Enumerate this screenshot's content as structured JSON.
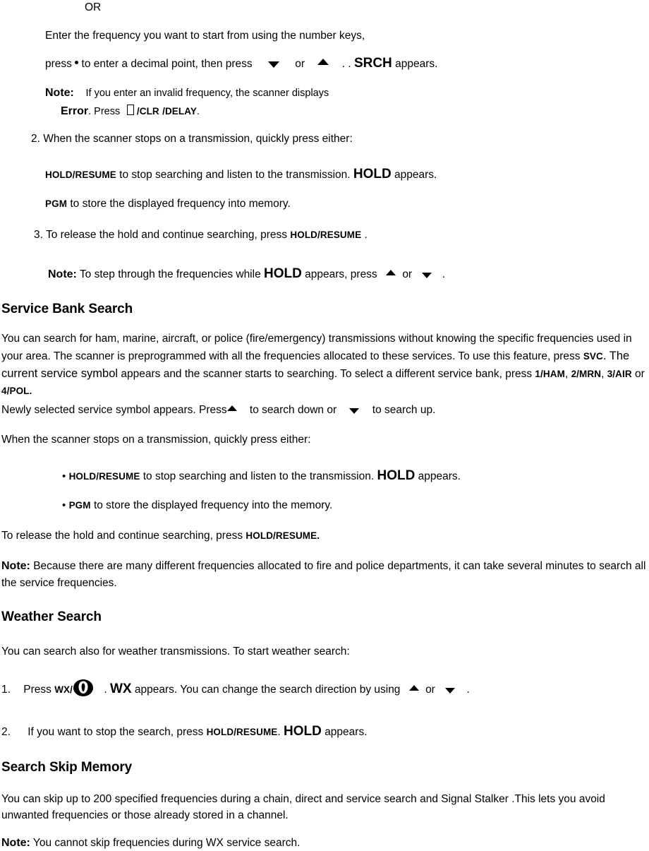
{
  "document": {
    "type": "scanner-manual-page",
    "background_color": "#ffffff",
    "text_color": "#000000"
  },
  "direct_search_continued": {
    "or_label": "OR",
    "enter_freq_line1": "Enter the frequency you want to start from using the number keys,",
    "enter_freq_line2_a": "press",
    "enter_freq_line2_b": "to enter a decimal point, then press",
    "enter_freq_line2_c": "or",
    "enter_freq_line2_d": ". .",
    "enter_freq_line2_srch": "SRCH",
    "enter_freq_line2_e": "appears.",
    "note_label": "Note:",
    "note_text_line1": "If you enter an invalid frequency, the scanner displays",
    "note_error_word": "Error",
    "note_press": ". Press",
    "note_clr": "/CLR",
    "note_delay": "/DELAY",
    "note_period": ".",
    "step2_number": "2.",
    "step2_text": "When the scanner stops on a transmission, quickly press either:",
    "step2_hold_key": "HOLD/RESUME",
    "step2_hold_text": "to stop searching and listen to the transmission.",
    "step2_hold_display": "HOLD",
    "step2_hold_appears": "appears.",
    "step2_pgm_key": "PGM",
    "step2_pgm_text": "to store the displayed frequency into memory.",
    "step3_number": "3.",
    "step3_text_a": "To release the hold and continue searching, press",
    "step3_key": "HOLD/RESUME",
    "step3_text_b": ".",
    "step3_note_label": "Note:",
    "step3_note_a": "To step through the frequencies while",
    "step3_note_hold": "HOLD",
    "step3_note_b": "appears, press",
    "step3_note_or": "or",
    "step3_note_c": "."
  },
  "service_bank_search": {
    "heading": "Service Bank Search",
    "para1_a": "You can search for ham, marine, aircraft, or police (fire/emergency) transmissions without knowing the specific frequencies used in your area. The scanner is preprogrammed with all the frequencies allocated to these services. To use this feature, press",
    "para1_svc": "SVC",
    "para1_b": ". The current service symbol",
    "para1_c": "appears and the scanner starts to searching. To select a different service bank, press",
    "bank_1": "1/HAM",
    "bank_sep1": ",",
    "bank_2": "2/MRN",
    "bank_sep2": ",",
    "bank_3": "3/AIR",
    "bank_or": "or",
    "bank_4": "4/POL.",
    "para2_a": "Newly selected service symbol appears. Press",
    "para2_b": "to search down or",
    "para2_c": "to search up.",
    "para3": "When the scanner stops on a transmission, quickly press either:",
    "bullet1_mark": "•",
    "bullet1_key": "HOLD/RESUME",
    "bullet1_text": "to stop searching and listen to the transmission.",
    "bullet1_display": "HOLD",
    "bullet1_appears": "appears.",
    "bullet2_mark": "•",
    "bullet2_key": "PGM",
    "bullet2_text": "to store the displayed frequency into the memory.",
    "release_a": "To release the hold and continue searching, press",
    "release_key": "HOLD/RESUME.",
    "note_label": "Note:",
    "note_text": "Because there are many different frequencies allocated to fire and police departments, it can take several minutes to search all the service frequencies."
  },
  "weather_search": {
    "heading": "Weather Search",
    "intro": "You can search also for weather transmissions. To start weather search:",
    "step1_number": "1.",
    "step1_press": "Press",
    "step1_key": "WX/",
    "step1_icon": "weather-symbol-icon",
    "step1_a": ".",
    "step1_wx": "WX",
    "step1_b": "appears. You can change the search direction by using",
    "step1_or": "or",
    "step1_c": ".",
    "step2_number": "2.",
    "step2_a": "If you want to stop the search, press",
    "step2_key": "HOLD/RESUME",
    "step2_b": ".",
    "step2_hold": "HOLD",
    "step2_c": "appears."
  },
  "search_skip_memory": {
    "heading": "Search Skip Memory",
    "para1": "You can skip up to 200 specified frequencies during a chain, direct and service search and Signal Stalker .This lets you avoid unwanted frequencies or those already stored in a channel.",
    "note_label": "Note:",
    "note_text": "You cannot skip frequencies during WX service search."
  }
}
